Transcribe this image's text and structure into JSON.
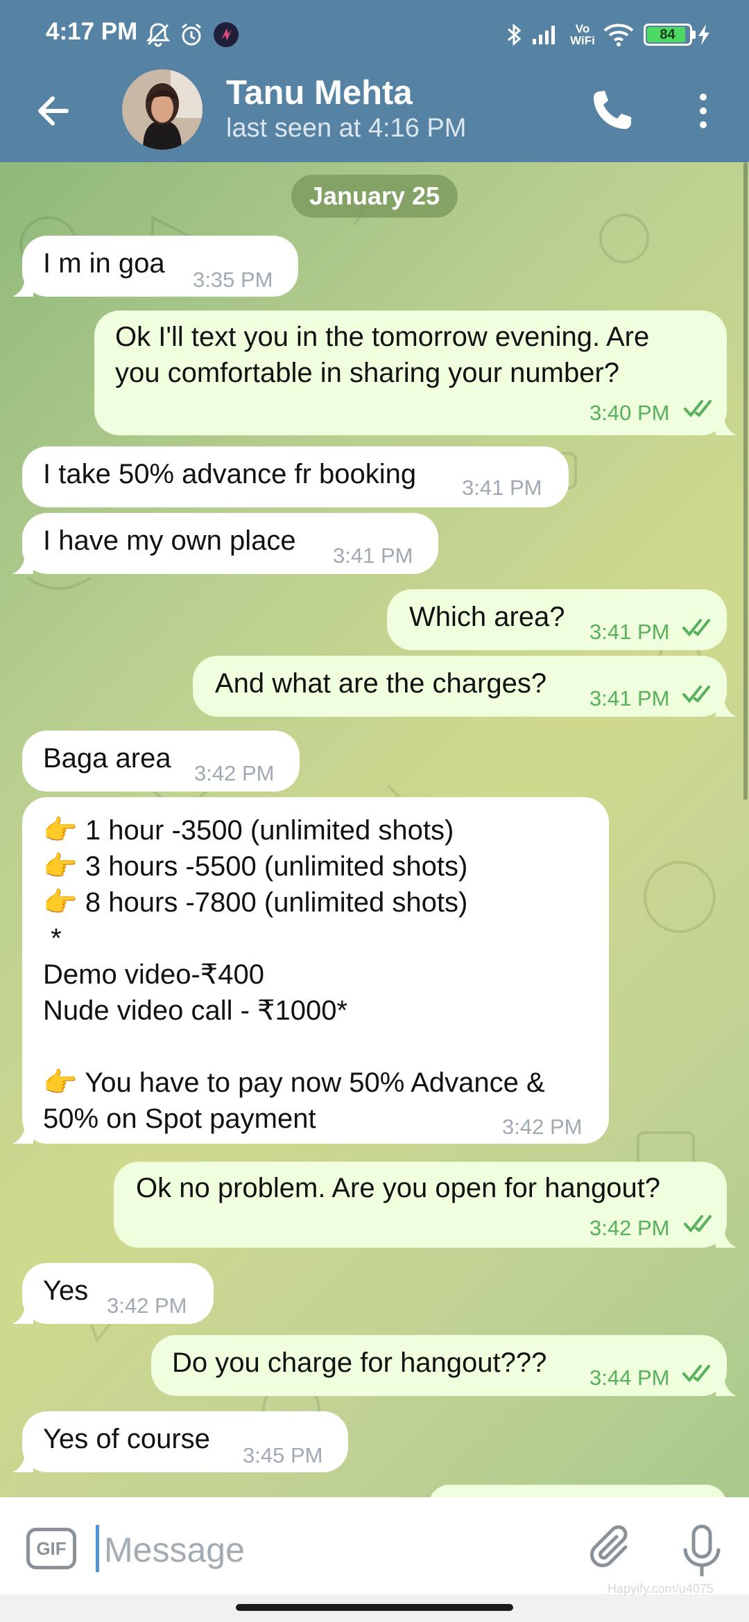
{
  "status_bar": {
    "time": "4:17 PM",
    "battery": "84",
    "icons": [
      "mute-bell-icon",
      "alarm-icon",
      "app-notification-icon",
      "bluetooth-icon",
      "signal-icon",
      "vowifi-icon",
      "wifi-icon",
      "battery-icon",
      "charging-icon"
    ],
    "vowifi_label": "Vo\nWiFi"
  },
  "header": {
    "contact_name": "Tanu Mehta",
    "last_seen": "last seen at 4:16 PM",
    "accent_color": "#5682a3"
  },
  "chat": {
    "date": "January 25",
    "messages": [
      {
        "dir": "in",
        "text": "I m in goa",
        "time": "3:35 PM"
      },
      {
        "dir": "out",
        "text": "Ok I'll text you in the tomorrow evening. Are\nyou comfortable in sharing your number?",
        "time": "3:40 PM",
        "read": true
      },
      {
        "dir": "in",
        "text": "I take 50% advance fr booking",
        "time": "3:41 PM"
      },
      {
        "dir": "in",
        "text": "I have my own place",
        "time": "3:41 PM"
      },
      {
        "dir": "out",
        "text": "Which area?",
        "time": "3:41 PM",
        "read": true
      },
      {
        "dir": "out",
        "text": "And what are the charges?",
        "time": "3:41 PM",
        "read": true
      },
      {
        "dir": "in",
        "text": "Baga area",
        "time": "3:42 PM"
      },
      {
        "dir": "in",
        "text": "👉 1 hour -3500 (unlimited shots)\n👉 3 hours -5500 (unlimited shots)\n👉 8 hours -7800 (unlimited shots)\n *\nDemo video-₹400\nNude video call - ₹1000*\n\n👉 You have to pay now 50% Advance &\n50% on Spot payment",
        "time": "3:42 PM"
      },
      {
        "dir": "out",
        "text": "Ok no problem. Are you open for hangout?",
        "time": "3:42 PM",
        "read": true
      },
      {
        "dir": "in",
        "text": "Yes",
        "time": "3:42 PM"
      },
      {
        "dir": "out",
        "text": "Do you charge for hangout???",
        "time": "3:44 PM",
        "read": true
      },
      {
        "dir": "in",
        "text": "Yes of course",
        "time": "3:45 PM"
      }
    ]
  },
  "input": {
    "gif_label": "GIF",
    "placeholder": "Message",
    "value": ""
  },
  "watermark": "Hapyify.com/u4075"
}
